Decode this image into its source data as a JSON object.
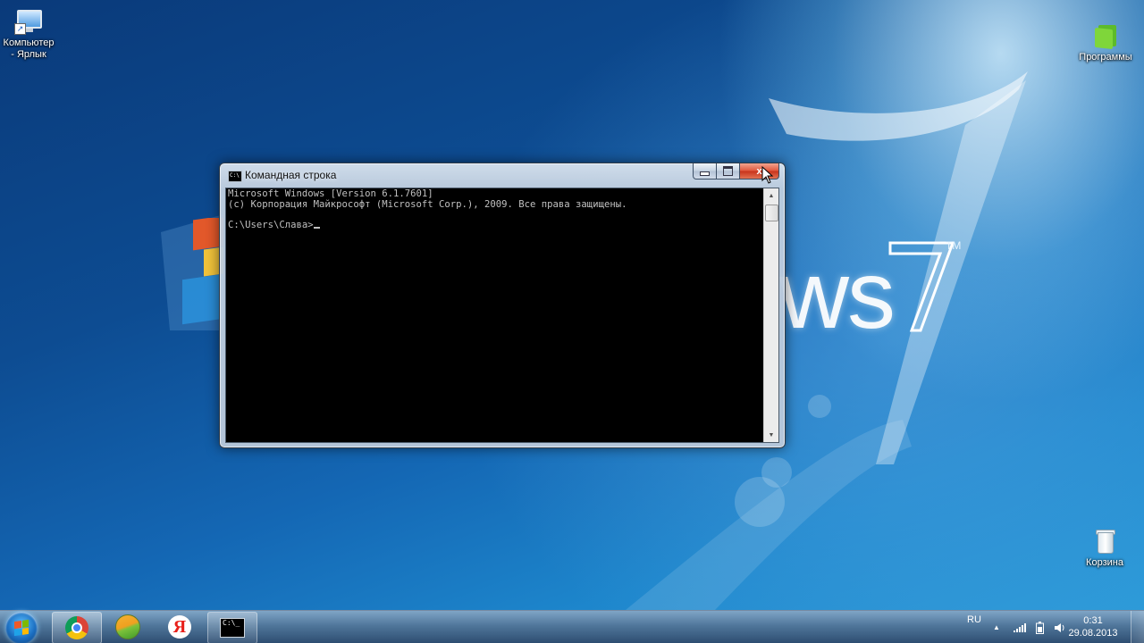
{
  "desktop": {
    "icons": [
      {
        "label_line1": "Компьютер",
        "label_line2": "- Ярлык",
        "icon": "computer-shortcut-icon"
      },
      {
        "label": "Программы",
        "icon": "green-folder-icon"
      },
      {
        "label": "Корзина",
        "icon": "recycle-bin-icon"
      }
    ],
    "wallpaper": {
      "text": "ws 7",
      "tm": "TM"
    }
  },
  "cmd_window": {
    "title": "Командная строка",
    "icon": "cmd-icon",
    "console_lines": [
      "Microsoft Windows [Version 6.1.7601]",
      "(c) Корпорация Майкрософт (Microsoft Corp.), 2009. Все права защищены.",
      "",
      "C:\\Users\\Слава>"
    ],
    "controls": {
      "minimize": "minimize",
      "maximize": "maximize",
      "close": "x"
    }
  },
  "taskbar": {
    "start": "start-orb",
    "items": [
      {
        "name": "chrome",
        "icon": "chrome-icon"
      },
      {
        "name": "ball-app",
        "icon": "ball-app-icon"
      },
      {
        "name": "yandex",
        "icon": "yandex-icon",
        "glyph": "Я"
      },
      {
        "name": "cmd",
        "icon": "cmd-icon"
      }
    ],
    "tray": {
      "language": "RU",
      "time": "0:31",
      "date": "29.08.2013"
    }
  },
  "colors": {
    "close_button": "#e0553a",
    "console_bg": "#000000",
    "console_fg": "#c0c0c0",
    "accent": "#1467b4"
  }
}
